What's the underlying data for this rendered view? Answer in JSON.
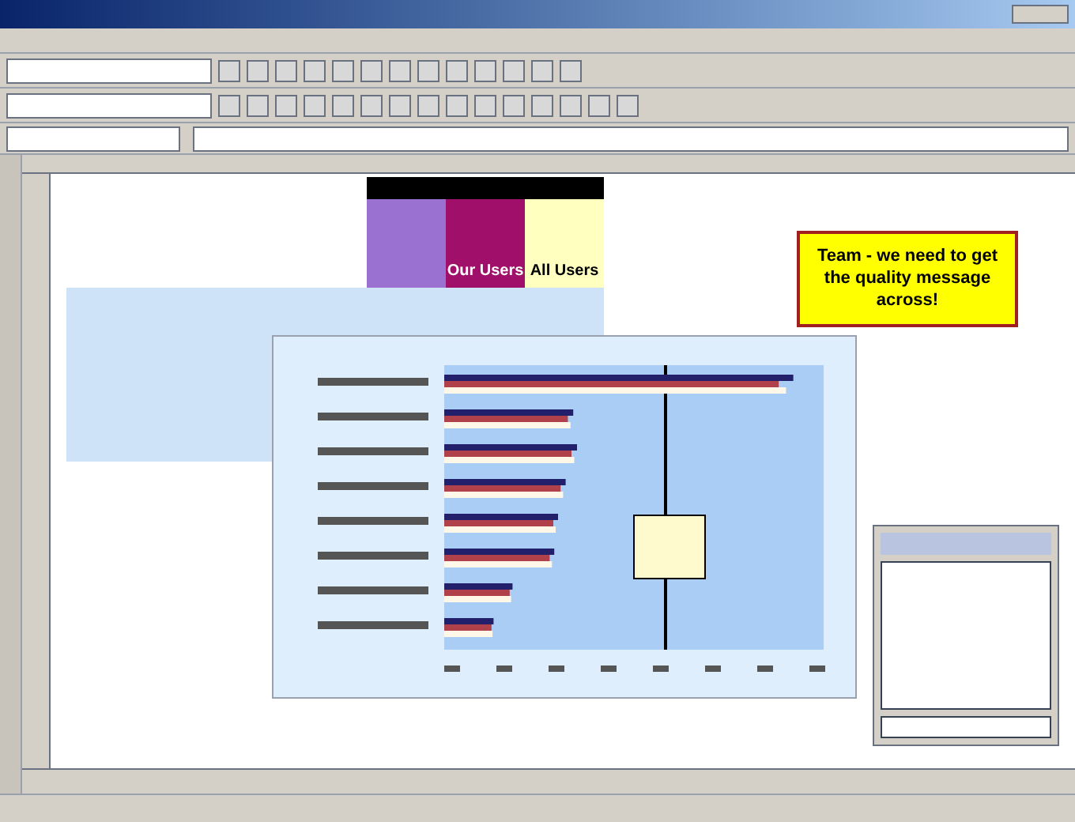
{
  "table": {
    "columns": [
      {
        "label": "Our Users",
        "color": "#a0106a"
      },
      {
        "label": "All Users",
        "color": "#ffffc0"
      }
    ]
  },
  "callout": {
    "text": "Team - we need to get the quality message across!"
  }
}
